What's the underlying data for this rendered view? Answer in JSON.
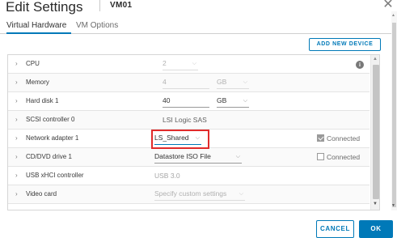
{
  "header": {
    "title": "Edit Settings",
    "vm_name": "VM01",
    "close_icon": "close-icon"
  },
  "tabs": [
    {
      "label": "Virtual Hardware",
      "active": true
    },
    {
      "label": "VM Options",
      "active": false
    }
  ],
  "toolbar": {
    "add_device_label": "ADD NEW DEVICE"
  },
  "hardware": {
    "cpu": {
      "label": "CPU",
      "value": "2"
    },
    "memory": {
      "label": "Memory",
      "value": "4",
      "unit": "GB"
    },
    "hard_disk": {
      "label": "Hard disk 1",
      "value": "40",
      "unit": "GB"
    },
    "scsi": {
      "label": "SCSI controller 0",
      "value": "LSI Logic SAS"
    },
    "network": {
      "label": "Network adapter 1",
      "value": "LS_Shared",
      "connected_label": "Connected",
      "connected": true
    },
    "cdrom": {
      "label": "CD/DVD drive 1",
      "value": "Datastore ISO File",
      "connected_label": "Connected",
      "connected": false
    },
    "usb": {
      "label": "USB xHCI controller",
      "value": "USB 3.0"
    },
    "video": {
      "label": "Video card",
      "value": "Specify custom settings"
    }
  },
  "icons": {
    "info": "i",
    "chevron": "›",
    "caret": "⌄"
  },
  "footer": {
    "cancel_label": "CANCEL",
    "ok_label": "OK"
  },
  "colors": {
    "accent": "#0079b8",
    "highlight_box": "#e12b2b"
  }
}
